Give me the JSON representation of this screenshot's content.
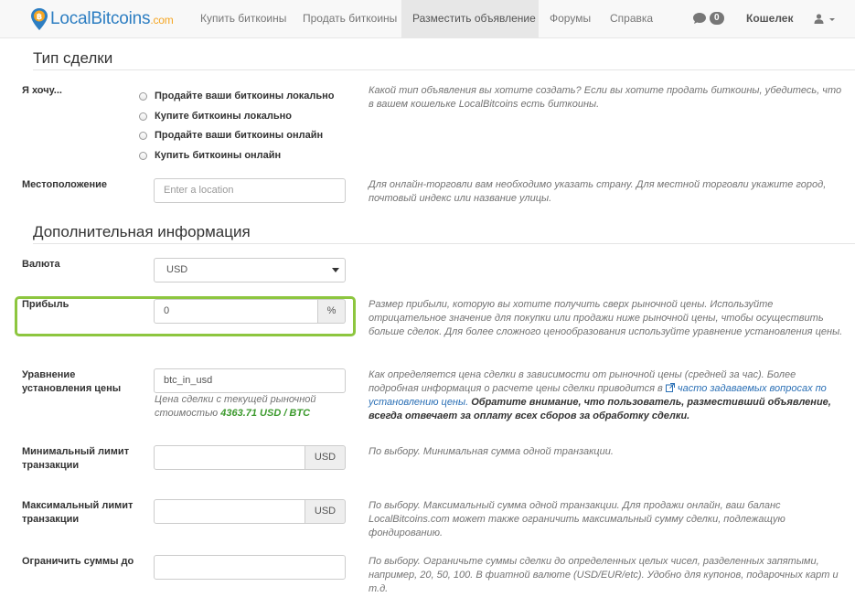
{
  "navbar": {
    "logo_main": "LocalBitcoins",
    "logo_domain": ".com",
    "items": [
      {
        "label": "Купить биткоины"
      },
      {
        "label": "Продать биткоины"
      },
      {
        "label": "Разместить объявление"
      },
      {
        "label": "Форумы"
      },
      {
        "label": "Справка"
      }
    ],
    "chat_count": "0",
    "wallet_label": "Кошелек"
  },
  "trade_type": {
    "title": "Тип сделки",
    "label": "Я хочу...",
    "options": [
      "Продайте ваши биткоины локально",
      "Купите биткоины локально",
      "Продайте ваши биткоины онлайн",
      "Купить биткоины онлайн"
    ],
    "help": "Какой тип объявления вы хотите создать? Если вы хотите продать биткоины, убедитесь, что в вашем кошельке LocalBitcoins есть биткоины."
  },
  "location": {
    "label": "Местоположение",
    "placeholder": "Enter a location",
    "help": "Для онлайн-торговли вам необходимо указать страну. Для местной торговли укажите город, почтовый индекс или название улицы."
  },
  "more_info": {
    "title": "Дополнительная информация"
  },
  "currency": {
    "label": "Валюта",
    "value": "USD"
  },
  "profit": {
    "label": "Прибыль",
    "value": "0",
    "addon": "%",
    "help": "Размер прибыли, которую вы хотите получить сверх рыночной цены. Используйте отрицательное значение для покупки или продажи ниже рыночной цены, чтобы осуществить больше сделок. Для более сложного ценообразования используйте уравнение установления цены."
  },
  "equation": {
    "label": "Уравнение установления цены",
    "value": "btc_in_usd",
    "sub_help_prefix": "Цена сделки с текущей рыночной стоимостью",
    "price": "4363.71 USD / BTC",
    "help_prefix": "Как определяется цена сделки в зависимости от рыночной цены (средней за час). Более подробная информация о расчете цены сделки приводится в",
    "help_link": "часто задаваемых вопросах по установлению цены.",
    "help_bold": "Обратите внимание, что пользователь, разместивший объявление, всегда отвечает за оплату всех сборов за обработку сделки."
  },
  "min_limit": {
    "label": "Минимальный лимит транзакции",
    "addon": "USD",
    "help": "По выбору. Минимальная сумма одной транзакции."
  },
  "max_limit": {
    "label": "Максимальный лимит транзакции",
    "addon": "USD",
    "help": "По выбору. Максимальный сумма одной транзакции. Для продажи онлайн, ваш баланс LocalBitcoins.com может также ограничить максимальный сумму сделки, подлежащую фондированию."
  },
  "restrict": {
    "label": "Ограничить суммы до",
    "help": "По выбору. Ограничьте суммы сделки до определенных целых чисел, разделенных запятыми, например, 20, 50, 100. В фиатной валюте (USD/EUR/etc). Удобно для купонов, подарочных карт и т.д."
  },
  "colors": {
    "brand_blue": "#2d7ec2",
    "brand_orange": "#f5a623",
    "highlight_green": "#8dc63f",
    "price_green": "#3c9a2d",
    "link_blue": "#2a6fb5"
  }
}
